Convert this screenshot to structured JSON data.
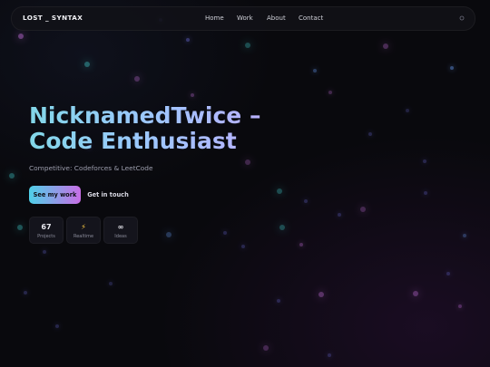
{
  "nav": {
    "brand": "LOST _ SYNTAX",
    "links": [
      "Home",
      "Work",
      "About",
      "Contact"
    ],
    "theme_toggle_icon": "sun-icon"
  },
  "hero": {
    "title_line1": "NicknamedTwice –",
    "title_line2": "Code Enthusiast",
    "subtitle": "Competitive: Codeforces & LeetCode",
    "primary_cta": "See my work",
    "secondary_cta": "Get in touch"
  },
  "stats": [
    {
      "value": "67",
      "label": "Projects"
    },
    {
      "value": "⚡",
      "label": "Realtime"
    },
    {
      "value": "∞",
      "label": "Ideas"
    }
  ],
  "colors": {
    "background": "#09090d",
    "accent_cyan": "#4fd0e8",
    "accent_magenta": "#c86ee6",
    "title_gradient_start": "#82d7e8",
    "title_gradient_end": "#b9b1ff"
  }
}
